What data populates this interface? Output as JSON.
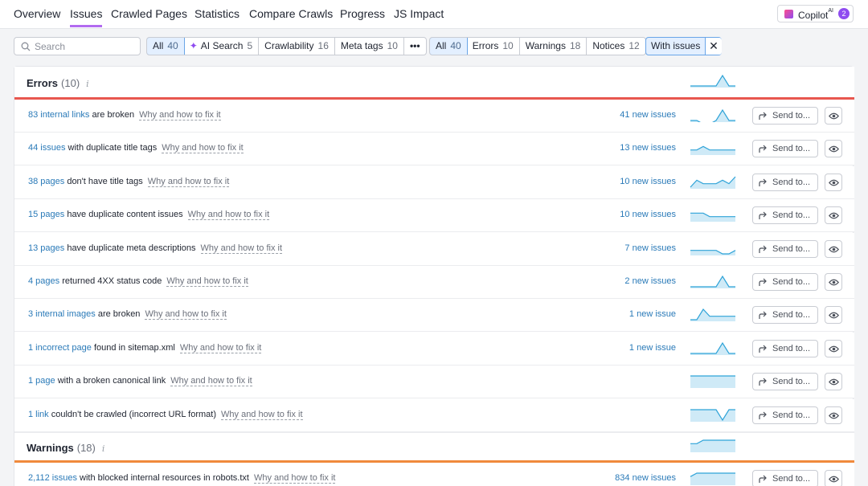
{
  "nav": {
    "tabs": [
      {
        "label": "Overview"
      },
      {
        "label": "Issues"
      },
      {
        "label": "Crawled Pages"
      },
      {
        "label": "Statistics"
      },
      {
        "label": "Compare Crawls"
      },
      {
        "label": "Progress"
      },
      {
        "label": "JS Impact"
      }
    ],
    "active_tab": "Issues",
    "copilot": {
      "label": "Copilot",
      "superscript": "AI",
      "badge": "2"
    }
  },
  "filters": {
    "search_placeholder": "Search",
    "category_group": [
      {
        "label": "All",
        "count": "40",
        "selected": true
      },
      {
        "label": "AI Search",
        "count": "5",
        "icon": "sparkle-icon"
      },
      {
        "label": "Crawlability",
        "count": "16"
      },
      {
        "label": "Meta tags",
        "count": "10"
      },
      {
        "label": "•••"
      }
    ],
    "severity_group": [
      {
        "label": "All",
        "count": "40",
        "selected": true
      },
      {
        "label": "Errors",
        "count": "10"
      },
      {
        "label": "Warnings",
        "count": "18"
      },
      {
        "label": "Notices",
        "count": "12"
      }
    ],
    "with_issues": {
      "label": "With issues",
      "clear": "✕"
    }
  },
  "colors": {
    "accent": "#b26bf0",
    "link": "#2a7ab8",
    "error_rule": "#e8574f",
    "warning_rule": "#f08a3c",
    "sparkline_stroke": "#2fa3d8",
    "sparkline_fill": "#cfeaf7"
  },
  "errors": {
    "title": "Errors",
    "count": "(10)",
    "info": "i",
    "rows": [
      {
        "link": "83 internal links",
        "text": " are broken",
        "why": "Why and how to fix it",
        "new": "41 new issues",
        "send": "Send to...",
        "spark": [
          4,
          4,
          5,
          5,
          4,
          1,
          4,
          4
        ]
      },
      {
        "link": "44 issues",
        "text": " with duplicate title tags",
        "why": "Why and how to fix it",
        "new": "13 new issues",
        "send": "Send to...",
        "spark": [
          3,
          3,
          2,
          3,
          3,
          3,
          3,
          3
        ]
      },
      {
        "link": "38 pages",
        "text": " don't have title tags",
        "why": "Why and how to fix it",
        "new": "10 new issues",
        "send": "Send to...",
        "spark": [
          4,
          2,
          3,
          3,
          3,
          2,
          3,
          1
        ]
      },
      {
        "link": "15 pages",
        "text": " have duplicate content issues",
        "why": "Why and how to fix it",
        "new": "10 new issues",
        "send": "Send to...",
        "spark": [
          2,
          2,
          2,
          3,
          3,
          3,
          3,
          3
        ]
      },
      {
        "link": "13 pages",
        "text": " have duplicate meta descriptions",
        "why": "Why and how to fix it",
        "new": "7 new issues",
        "send": "Send to...",
        "spark": [
          3,
          3,
          3,
          3,
          3,
          4,
          4,
          3
        ]
      },
      {
        "link": "4 pages",
        "text": " returned 4XX status code",
        "why": "Why and how to fix it",
        "new": "2 new issues",
        "send": "Send to...",
        "spark": [
          4,
          4,
          4,
          4,
          4,
          1,
          4,
          4
        ]
      },
      {
        "link": "3 internal images",
        "text": " are broken",
        "why": "Why and how to fix it",
        "new": "1 new issue",
        "send": "Send to...",
        "spark": [
          4,
          4,
          1,
          3,
          3,
          3,
          3,
          3
        ]
      },
      {
        "link": "1 incorrect page",
        "text": " found in sitemap.xml",
        "why": "Why and how to fix it",
        "new": "1 new issue",
        "send": "Send to...",
        "spark": [
          4,
          4,
          4,
          4,
          4,
          1,
          4,
          4
        ]
      },
      {
        "link": "1 page",
        "text": " with a broken canonical link",
        "why": "Why and how to fix it",
        "new": "",
        "send": "Send to...",
        "spark": [
          1,
          1,
          1,
          1,
          1,
          1,
          1,
          1
        ]
      },
      {
        "link": "1 link",
        "text": " couldn't be crawled (incorrect URL format)",
        "why": "Why and how to fix it",
        "new": "",
        "send": "Send to...",
        "spark": [
          1,
          1,
          1,
          1,
          1,
          4,
          1,
          1
        ]
      }
    ],
    "header_spark": [
      4,
      4,
      4,
      4,
      4,
      1,
      4,
      4
    ]
  },
  "warnings": {
    "title": "Warnings",
    "count": "(18)",
    "info": "i",
    "header_spark": [
      2,
      2,
      1,
      1,
      1,
      1,
      1,
      1
    ],
    "rows": [
      {
        "link": "2,112 issues",
        "text": " with blocked internal resources in robots.txt",
        "why": "Why and how to fix it",
        "new": "834 new issues",
        "send": "Send to...",
        "spark": [
          2,
          1,
          1,
          1,
          1,
          1,
          1,
          1
        ]
      }
    ]
  }
}
